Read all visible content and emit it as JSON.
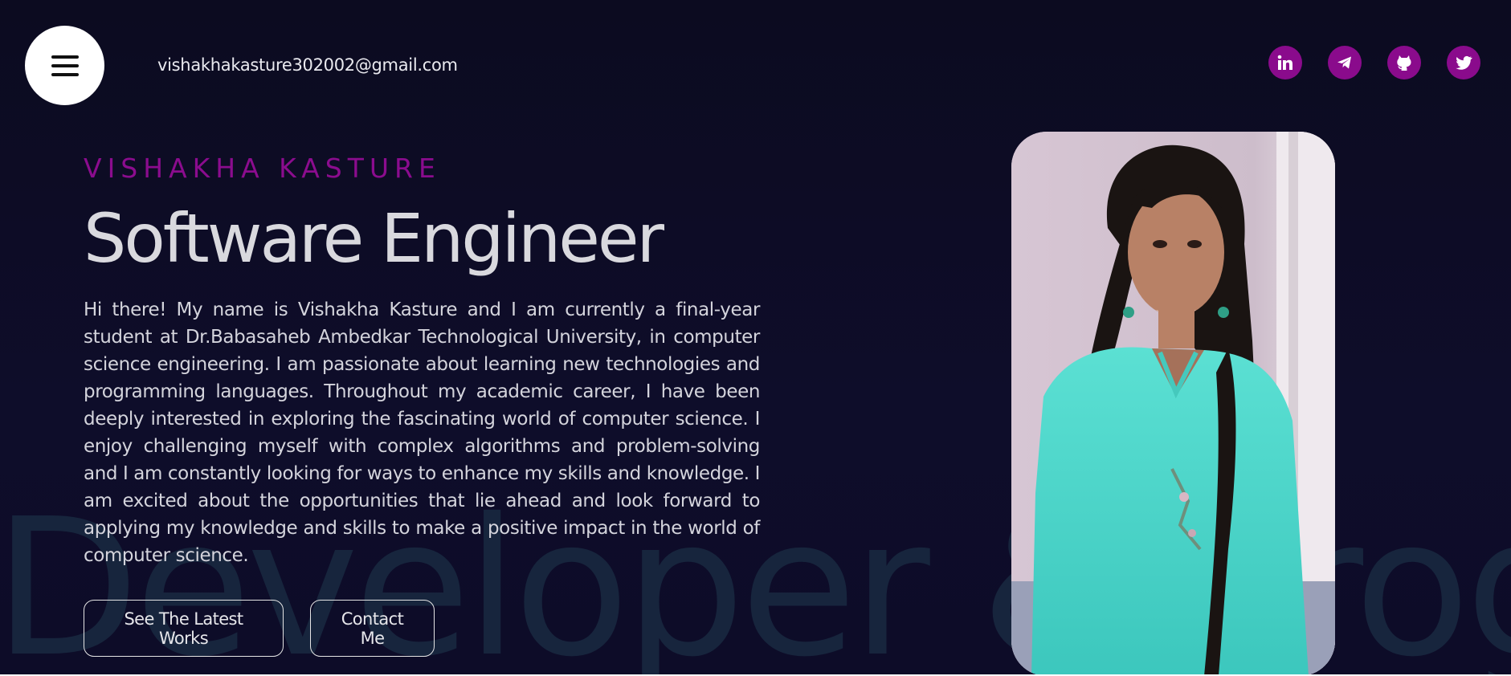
{
  "header": {
    "menu_icon": "hamburger-menu-icon",
    "email": "vishakhakasture302002@gmail.com",
    "socials": [
      {
        "name": "LinkedIn",
        "icon": "linkedin-icon"
      },
      {
        "name": "Telegram",
        "icon": "telegram-icon"
      },
      {
        "name": "GitHub",
        "icon": "github-icon"
      },
      {
        "name": "Twitter",
        "icon": "twitter-icon"
      }
    ]
  },
  "hero": {
    "name": "VISHAKHA KASTURE",
    "title": "Software Engineer",
    "about": "Hi there! My name is Vishakha Kasture and I am currently a final-year student at Dr.Babasaheb Ambedkar Technological University, in computer science engineering. I am passionate about learning new technologies and programming languages. Throughout my academic career, I have been deeply interested in exploring the fascinating world of computer science. I enjoy challenging myself with complex algorithms and problem-solving and I am constantly looking for ways to enhance my skills and knowledge. I am excited about the opportunities that lie ahead and look forward to applying my knowledge and skills to make a positive impact in the world of computer science.",
    "primary_button": "See The Latest Works",
    "secondary_button": "Contact Me"
  },
  "background_text": "Developer & Programmer",
  "colors": {
    "background": "#0d0c24",
    "accent": "#8a0b8c",
    "text": "#d9d9de",
    "background_text": "#17253d"
  }
}
